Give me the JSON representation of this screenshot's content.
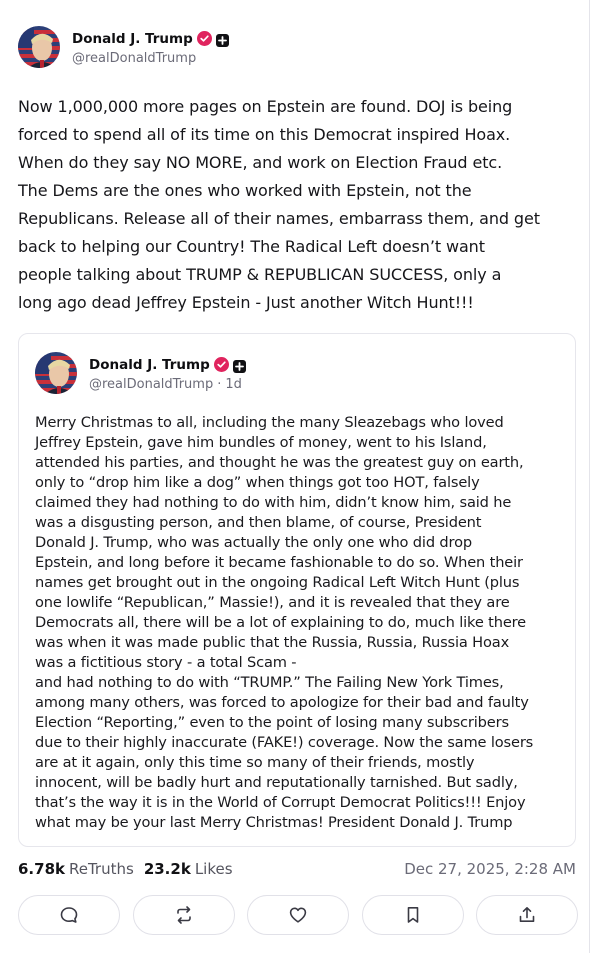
{
  "post": {
    "author": {
      "display_name": "Donald J. Trump",
      "handle": "@realDonaldTrump",
      "verified": true,
      "badges": [
        "verified-check-icon",
        "plus-badge-icon"
      ]
    },
    "text": "Now 1,000,000 more pages on Epstein are found. DOJ is being\nforced to spend all of its time on this Democrat inspired Hoax.\nWhen do they say NO MORE, and work on Election Fraud etc.\nThe Dems are the ones who worked with Epstein, not the\nRepublicans. Release all of their names, embarrass them, and get\nback to helping our Country! The Radical Left doesn’t want\npeople talking about TRUMP & REPUBLICAN SUCCESS, only a\nlong ago dead Jeffrey Epstein - Just another Witch Hunt!!!",
    "quote": {
      "author": {
        "display_name": "Donald J. Trump",
        "handle": "@realDonaldTrump",
        "age": "1d"
      },
      "separator": "·",
      "text": "Merry Christmas to all, including the many Sleazebags who loved\nJeffrey Epstein, gave him bundles of money, went to his Island,\nattended his parties, and thought he was the greatest guy on earth,\nonly to “drop him like a dog” when things got too HOT, falsely\nclaimed they had nothing to do with him, didn’t know him, said he\nwas a disgusting person, and then blame, of course, President\nDonald J. Trump, who was actually the only one who did drop\nEpstein, and long before it became fashionable to do so. When their\nnames get brought out in the ongoing Radical Left Witch Hunt (plus\none lowlife “Republican,” Massie!), and it is revealed that they are\nDemocrats all, there will be a lot of explaining to do, much like there\nwas when it was made public that the Russia, Russia, Russia Hoax\nwas a fictitious story - a total Scam -\nand had nothing to do with “TRUMP.” The Failing New York Times,\namong many others, was forced to apologize for their bad and faulty\nElection “Reporting,” even to the point of losing many subscribers\ndue to their highly inaccurate (FAKE!) coverage. Now the same losers\nare at it again, only this time so many of their friends, mostly\ninnocent, will be badly hurt and reputationally tarnished. But sadly,\nthat’s the way it is in the World of Corrupt Democrat Politics!!! Enjoy\nwhat may be your last Merry Christmas! President Donald J. Trump"
    },
    "stats": {
      "retruths_count": "6.78k",
      "retruths_label": "ReTruths",
      "likes_count": "23.2k",
      "likes_label": "Likes"
    },
    "timestamp": "Dec 27, 2025, 2:28 AM",
    "actions": [
      "reply-icon",
      "retruth-icon",
      "like-icon",
      "bookmark-icon",
      "share-icon"
    ]
  },
  "colors": {
    "verified_badge": "#e0245e",
    "border": "#e4e4ea",
    "muted_text": "#6b6b78"
  }
}
